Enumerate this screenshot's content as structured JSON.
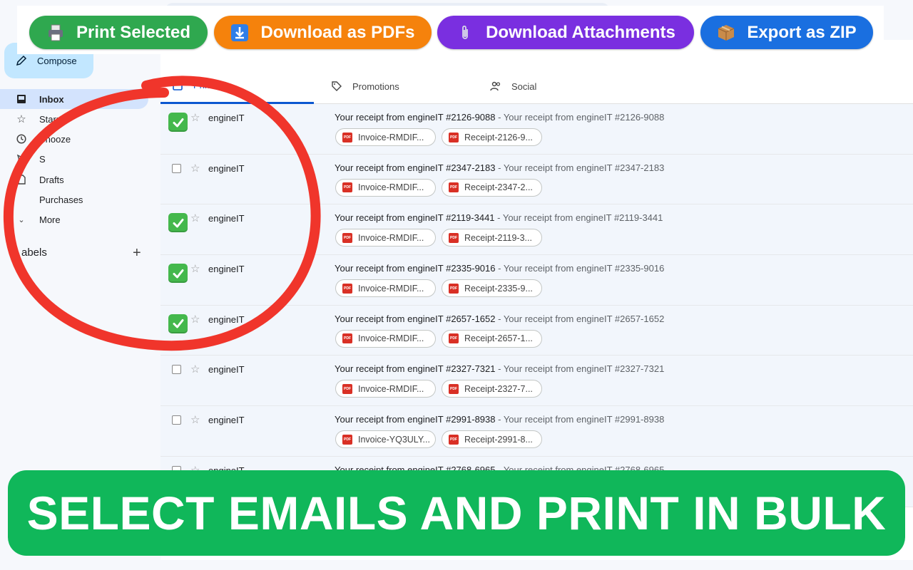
{
  "toolbar": {
    "buttons": [
      {
        "label": "Print Selected",
        "icon": "printer-icon",
        "color": "#2fa84f"
      },
      {
        "label": "Download as PDFs",
        "icon": "download-arrow-icon",
        "color": "#f5820c"
      },
      {
        "label": "Download Attachments",
        "icon": "paperclip-icon",
        "color": "#7a2fe0"
      },
      {
        "label": "Export as ZIP",
        "icon": "package-icon",
        "color": "#1a6fe0"
      }
    ]
  },
  "sidebar": {
    "compose_label": "Compose",
    "items": [
      {
        "label": "Inbox",
        "icon": "inbox-icon",
        "active": true
      },
      {
        "label": "Starred",
        "icon": "star-icon"
      },
      {
        "label": "Snooze",
        "icon": "clock-icon"
      },
      {
        "label": "S",
        "icon": "send-icon"
      },
      {
        "label": "Drafts",
        "icon": "draft-icon"
      },
      {
        "label": "Purchases",
        "icon": "tag-icon"
      },
      {
        "label": "More",
        "icon": "chevron-down-icon"
      }
    ],
    "labels_heading": "abels"
  },
  "tabs": [
    {
      "label": "Primary",
      "icon": "inbox-icon",
      "active": true
    },
    {
      "label": "Promotions",
      "icon": "tag-icon"
    },
    {
      "label": "Social",
      "icon": "people-icon"
    }
  ],
  "emails": [
    {
      "sender": "engineIT",
      "subject": "Your receipt from engineIT #2126-9088",
      "snippet": " - Your receipt from engineIT #2126-9088",
      "attachments": [
        "Invoice-RMDIF...",
        "Receipt-2126-9..."
      ],
      "selected": true
    },
    {
      "sender": "engineIT",
      "subject": "Your receipt from engineIT #2347-2183",
      "snippet": " - Your receipt from engineIT #2347-2183",
      "attachments": [
        "Invoice-RMDIF...",
        "Receipt-2347-2..."
      ],
      "selected": false
    },
    {
      "sender": "engineIT",
      "subject": "Your receipt from engineIT #2119-3441",
      "snippet": " - Your receipt from engineIT #2119-3441",
      "attachments": [
        "Invoice-RMDIF...",
        "Receipt-2119-3..."
      ],
      "selected": true
    },
    {
      "sender": "engineIT",
      "subject": "Your receipt from engineIT #2335-9016",
      "snippet": " - Your receipt from engineIT #2335-9016",
      "attachments": [
        "Invoice-RMDIF...",
        "Receipt-2335-9..."
      ],
      "selected": true
    },
    {
      "sender": "engineIT",
      "subject": "Your receipt from engineIT #2657-1652",
      "snippet": " - Your receipt from engineIT #2657-1652",
      "attachments": [
        "Invoice-RMDIF...",
        "Receipt-2657-1..."
      ],
      "selected": true
    },
    {
      "sender": "engineIT",
      "subject": "Your receipt from engineIT #2327-7321",
      "snippet": " - Your receipt from engineIT #2327-7321",
      "attachments": [
        "Invoice-RMDIF...",
        "Receipt-2327-7..."
      ],
      "selected": false
    },
    {
      "sender": "engineIT",
      "subject": "Your receipt from engineIT #2991-8938",
      "snippet": " - Your receipt from engineIT #2991-8938",
      "attachments": [
        "Invoice-YQ3ULY...",
        "Receipt-2991-8..."
      ],
      "selected": false
    },
    {
      "sender": "engineIT",
      "subject": "Your receipt from engineIT #2768-6965",
      "snippet": " - Your receipt from engineIT #2768-6965",
      "attachments": [],
      "selected": false
    }
  ],
  "banner": {
    "text": "SELECT EMAILS AND PRINT IN BULK",
    "color": "#10b75a"
  },
  "colors": {
    "annotation_circle": "#f0352b",
    "checked": "#44b84c",
    "primary_tab": "#0b57d0"
  }
}
